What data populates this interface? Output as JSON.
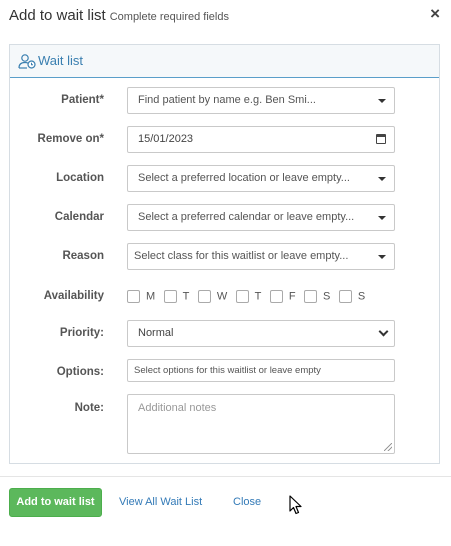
{
  "header": {
    "title": "Add to wait list",
    "subtitle": "Complete required fields",
    "close_glyph": "×"
  },
  "panel": {
    "heading": "Wait list",
    "heading_icon": "user-clock-icon"
  },
  "form": {
    "patient": {
      "label": "Patient*",
      "placeholder": "Find patient by name e.g. Ben Smi..."
    },
    "remove_on": {
      "label": "Remove on*",
      "value": "15/01/2023"
    },
    "location": {
      "label": "Location",
      "placeholder": "Select a preferred location or leave empty..."
    },
    "calendar": {
      "label": "Calendar",
      "placeholder": "Select a preferred calendar or leave empty..."
    },
    "reason": {
      "label": "Reason",
      "placeholder": "Select class for this waitlist or leave empty..."
    },
    "availability": {
      "label": "Availability",
      "days": [
        "M",
        "T",
        "W",
        "T",
        "F",
        "S",
        "S"
      ]
    },
    "priority": {
      "label": "Priority:",
      "value": "Normal"
    },
    "options": {
      "label": "Options:",
      "placeholder": "Select options for this waitlist or leave empty"
    },
    "note": {
      "label": "Note:",
      "placeholder": "Additional notes"
    }
  },
  "footer": {
    "add_label": "Add to wait list",
    "view_all_label": "View All Wait List",
    "close_label": "Close"
  },
  "colors": {
    "primary_button": "#5cb85c",
    "link": "#337ab7",
    "panel_heading_text": "#3a7fb0"
  }
}
